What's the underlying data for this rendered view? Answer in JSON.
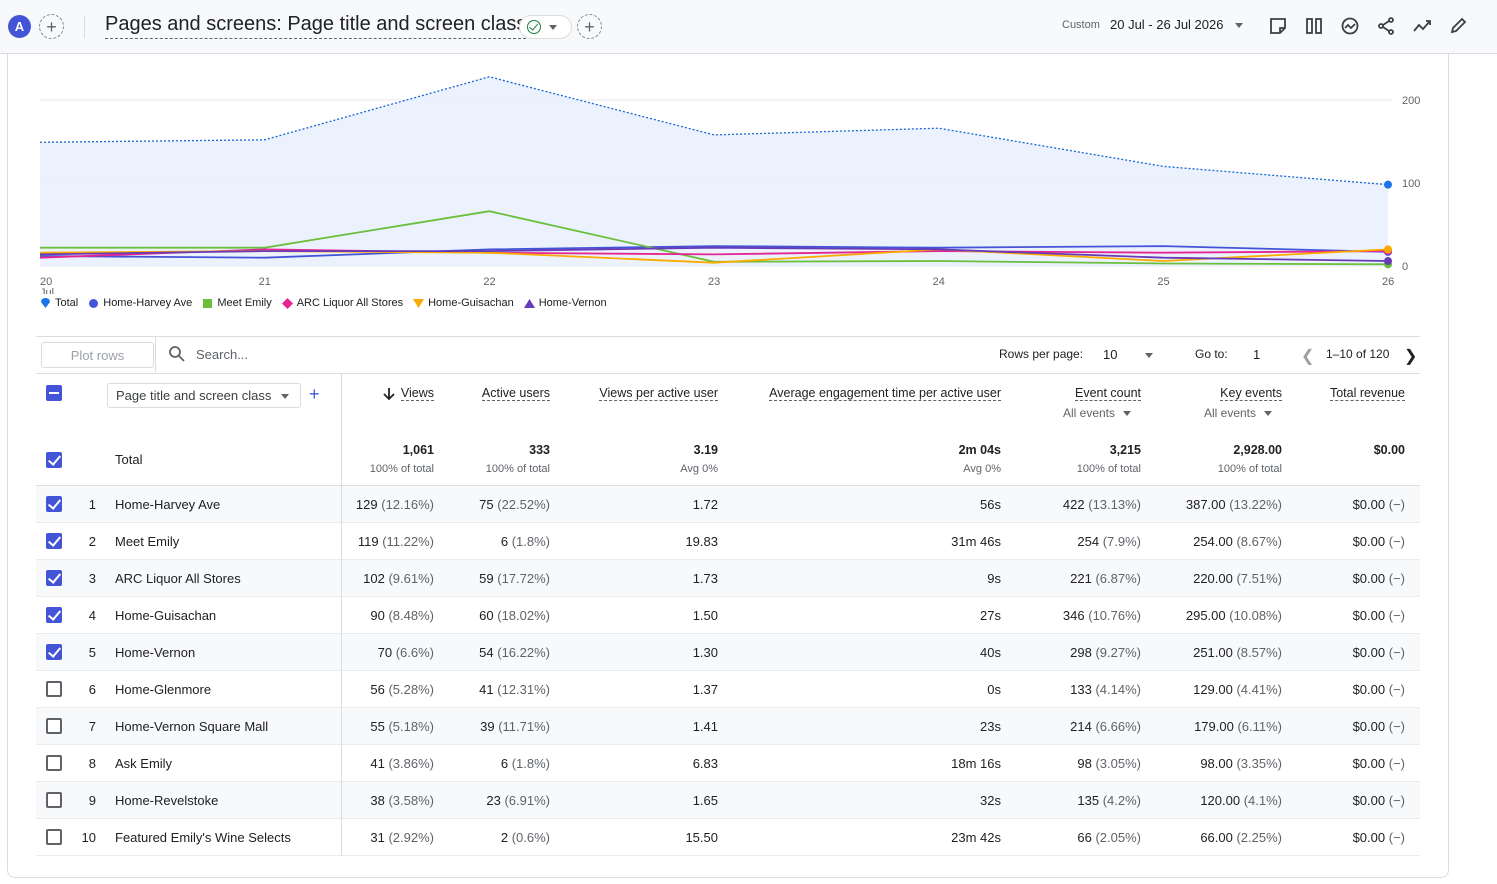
{
  "header": {
    "avatar_letter": "A",
    "title": "Pages and screens: Page title and screen class",
    "date_preset": "Custom",
    "date_range": "20 Jul - 26 Jul 2026",
    "tool_icons": [
      "note-icon",
      "compare-icon",
      "insights-icon",
      "share-icon",
      "trend-icon",
      "edit-icon"
    ]
  },
  "chart_data": {
    "type": "line",
    "x": [
      "20 Jul",
      "21",
      "22",
      "23",
      "24",
      "25",
      "26"
    ],
    "y_ticks": [
      "200",
      "100",
      "0"
    ],
    "ylim": [
      0,
      200
    ],
    "series": [
      {
        "name": "Total",
        "color": "#1a73e8",
        "values": [
          149,
          152,
          228,
          158,
          166,
          120,
          98
        ]
      },
      {
        "name": "Home-Harvey Ave",
        "color": "#4355d6",
        "values": [
          12,
          10,
          20,
          24,
          22,
          24,
          17
        ]
      },
      {
        "name": "Meet Emily",
        "color": "#6bbf3c",
        "values": [
          22,
          22,
          66,
          5,
          6,
          3,
          2
        ]
      },
      {
        "name": "ARC Liquor All Stores",
        "color": "#e52592",
        "values": [
          10,
          20,
          16,
          14,
          18,
          16,
          18
        ]
      },
      {
        "name": "Home-Guisachan",
        "color": "#f9ab00",
        "values": [
          16,
          18,
          16,
          4,
          20,
          6,
          20
        ]
      },
      {
        "name": "Home-Vernon",
        "color": "#673ab7",
        "values": [
          14,
          18,
          18,
          22,
          20,
          10,
          6
        ]
      }
    ]
  },
  "toolbar": {
    "plot_rows_label": "Plot rows",
    "search_placeholder": "Search...",
    "rows_per_page_label": "Rows per page:",
    "rows_per_page_value": "10",
    "goto_label": "Go to:",
    "goto_value": "1",
    "page_range": "1–10 of 120"
  },
  "table": {
    "dimension_label": "Page title and screen class",
    "columns": [
      {
        "label": "Views",
        "sub": ""
      },
      {
        "label": "Active users",
        "sub": ""
      },
      {
        "label": "Views per active user",
        "sub": ""
      },
      {
        "label": "Average engagement time per active user",
        "sub": ""
      },
      {
        "label": "Event count",
        "sub": "All events"
      },
      {
        "label": "Key events",
        "sub": "All events"
      },
      {
        "label": "Total revenue",
        "sub": ""
      }
    ],
    "total": {
      "label": "Total",
      "values": [
        "1,061",
        "333",
        "3.19",
        "2m 04s",
        "3,215",
        "2,928.00",
        "$0.00"
      ],
      "subs": [
        "100% of total",
        "100% of total",
        "Avg 0%",
        "Avg 0%",
        "100% of total",
        "100% of total",
        ""
      ]
    },
    "rows": [
      {
        "n": "1",
        "checked": true,
        "name": "Home-Harvey Ave",
        "c": [
          [
            "129",
            "(12.16%)"
          ],
          [
            "75",
            "(22.52%)"
          ],
          [
            "1.72",
            ""
          ],
          [
            "56s",
            ""
          ],
          [
            "422",
            "(13.13%)"
          ],
          [
            "387.00",
            "(13.22%)"
          ],
          [
            "$0.00",
            "(−)"
          ]
        ]
      },
      {
        "n": "2",
        "checked": true,
        "name": "Meet Emily",
        "c": [
          [
            "119",
            "(11.22%)"
          ],
          [
            "6",
            "(1.8%)"
          ],
          [
            "19.83",
            ""
          ],
          [
            "31m 46s",
            ""
          ],
          [
            "254",
            "(7.9%)"
          ],
          [
            "254.00",
            "(8.67%)"
          ],
          [
            "$0.00",
            "(−)"
          ]
        ]
      },
      {
        "n": "3",
        "checked": true,
        "name": "ARC Liquor All Stores",
        "c": [
          [
            "102",
            "(9.61%)"
          ],
          [
            "59",
            "(17.72%)"
          ],
          [
            "1.73",
            ""
          ],
          [
            "9s",
            ""
          ],
          [
            "221",
            "(6.87%)"
          ],
          [
            "220.00",
            "(7.51%)"
          ],
          [
            "$0.00",
            "(−)"
          ]
        ]
      },
      {
        "n": "4",
        "checked": true,
        "name": "Home-Guisachan",
        "c": [
          [
            "90",
            "(8.48%)"
          ],
          [
            "60",
            "(18.02%)"
          ],
          [
            "1.50",
            ""
          ],
          [
            "27s",
            ""
          ],
          [
            "346",
            "(10.76%)"
          ],
          [
            "295.00",
            "(10.08%)"
          ],
          [
            "$0.00",
            "(−)"
          ]
        ]
      },
      {
        "n": "5",
        "checked": true,
        "name": "Home-Vernon",
        "c": [
          [
            "70",
            "(6.6%)"
          ],
          [
            "54",
            "(16.22%)"
          ],
          [
            "1.30",
            ""
          ],
          [
            "40s",
            ""
          ],
          [
            "298",
            "(9.27%)"
          ],
          [
            "251.00",
            "(8.57%)"
          ],
          [
            "$0.00",
            "(−)"
          ]
        ]
      },
      {
        "n": "6",
        "checked": false,
        "name": "Home-Glenmore",
        "c": [
          [
            "56",
            "(5.28%)"
          ],
          [
            "41",
            "(12.31%)"
          ],
          [
            "1.37",
            ""
          ],
          [
            "0s",
            ""
          ],
          [
            "133",
            "(4.14%)"
          ],
          [
            "129.00",
            "(4.41%)"
          ],
          [
            "$0.00",
            "(−)"
          ]
        ]
      },
      {
        "n": "7",
        "checked": false,
        "name": "Home-Vernon Square Mall",
        "c": [
          [
            "55",
            "(5.18%)"
          ],
          [
            "39",
            "(11.71%)"
          ],
          [
            "1.41",
            ""
          ],
          [
            "23s",
            ""
          ],
          [
            "214",
            "(6.66%)"
          ],
          [
            "179.00",
            "(6.11%)"
          ],
          [
            "$0.00",
            "(−)"
          ]
        ]
      },
      {
        "n": "8",
        "checked": false,
        "name": "Ask Emily",
        "c": [
          [
            "41",
            "(3.86%)"
          ],
          [
            "6",
            "(1.8%)"
          ],
          [
            "6.83",
            ""
          ],
          [
            "18m 16s",
            ""
          ],
          [
            "98",
            "(3.05%)"
          ],
          [
            "98.00",
            "(3.35%)"
          ],
          [
            "$0.00",
            "(−)"
          ]
        ]
      },
      {
        "n": "9",
        "checked": false,
        "name": "Home-Revelstoke",
        "c": [
          [
            "38",
            "(3.58%)"
          ],
          [
            "23",
            "(6.91%)"
          ],
          [
            "1.65",
            ""
          ],
          [
            "32s",
            ""
          ],
          [
            "135",
            "(4.2%)"
          ],
          [
            "120.00",
            "(4.1%)"
          ],
          [
            "$0.00",
            "(−)"
          ]
        ]
      },
      {
        "n": "10",
        "checked": false,
        "name": "Featured Emily's Wine Selects",
        "c": [
          [
            "31",
            "(2.92%)"
          ],
          [
            "2",
            "(0.6%)"
          ],
          [
            "15.50",
            ""
          ],
          [
            "23m 42s",
            ""
          ],
          [
            "66",
            "(2.05%)"
          ],
          [
            "66.00",
            "(2.25%)"
          ],
          [
            "$0.00",
            "(−)"
          ]
        ]
      }
    ]
  }
}
